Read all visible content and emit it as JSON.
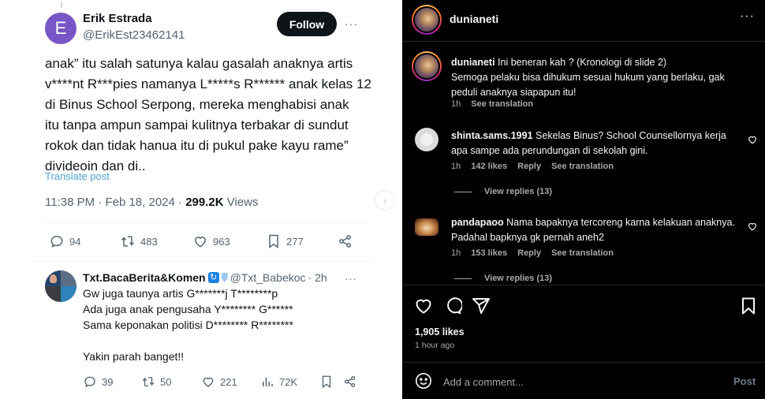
{
  "twitter": {
    "main_tweet": {
      "avatar_letter": "E",
      "author_name": "Erik Estrada",
      "author_handle": "@ErikEst23462141",
      "follow_label": "Follow",
      "more_label": "···",
      "body_lines": [
        "anak” itu salah satunya kalau gasalah anaknya artis",
        "v****nt R***pies namanya L*****s R****** anak kelas 12",
        "di Binus School Serpong, mereka menghabisi anak",
        "itu tanpa ampun sampai kulitnya terbakar di sundut",
        "rokok dan tidak hanua itu di pukul pake kayu rame”",
        "divideoin dan di.."
      ],
      "translate_label": "Translate post",
      "time": "11:38 PM",
      "date": "Feb 18, 2024",
      "views_count": "299.2K",
      "views_label": "Views",
      "separator": " · ",
      "stats": {
        "replies": "94",
        "reposts": "483",
        "likes": "963",
        "bookmarks": "277"
      }
    },
    "next_arrow": "›",
    "reply_tweet": {
      "author_name": "Txt.BacaBerita&Komen",
      "badge_icon": "↻",
      "author_handle": "@Txt_Babekoc",
      "time_ago": "· 2h",
      "more_label": "···",
      "body_lines": [
        "Gw juga taunya artis G*******j T********p",
        "Ada juga anak pengusaha Y******** G******",
        "Sama keponakan politisi D******** R********",
        "",
        "Yakin parah banget!!"
      ],
      "stats": {
        "replies": "39",
        "reposts": "50",
        "likes": "221",
        "views": "72K"
      }
    }
  },
  "instagram": {
    "header": {
      "username": "dunianeti",
      "more_label": "···"
    },
    "caption": {
      "username": "dunianeti",
      "text_line1": "Ini beneran kah ? (Kronologi di slide 2)",
      "text_rest": "Semoga pelaku bisa dihukum sesuai hukum yang berlaku, gak peduli anaknya siapapun itu!",
      "time": "1h",
      "see_translation": "See translation"
    },
    "comments": [
      {
        "username": "shinta.sams.1991",
        "text": "Sekelas Binus? School Counsellornya kerja apa sampe ada perundungan di sekolah gini.",
        "time": "1h",
        "likes": "142 likes",
        "reply_label": "Reply",
        "see_translation": "See translation",
        "view_replies": "View replies (13)"
      },
      {
        "username": "pandapaoo",
        "text": "Nama bapaknya tercoreng karna kelakuan anaknya. Padahal bapknya gk pernah aneh2",
        "time": "1h",
        "likes": "153 likes",
        "reply_label": "Reply",
        "see_translation": "See translation",
        "view_replies": "View replies (13)"
      }
    ],
    "likes_count": "1,905 likes",
    "time_ago": "1 hour ago",
    "comment_placeholder": "Add a comment...",
    "post_label": "Post"
  }
}
